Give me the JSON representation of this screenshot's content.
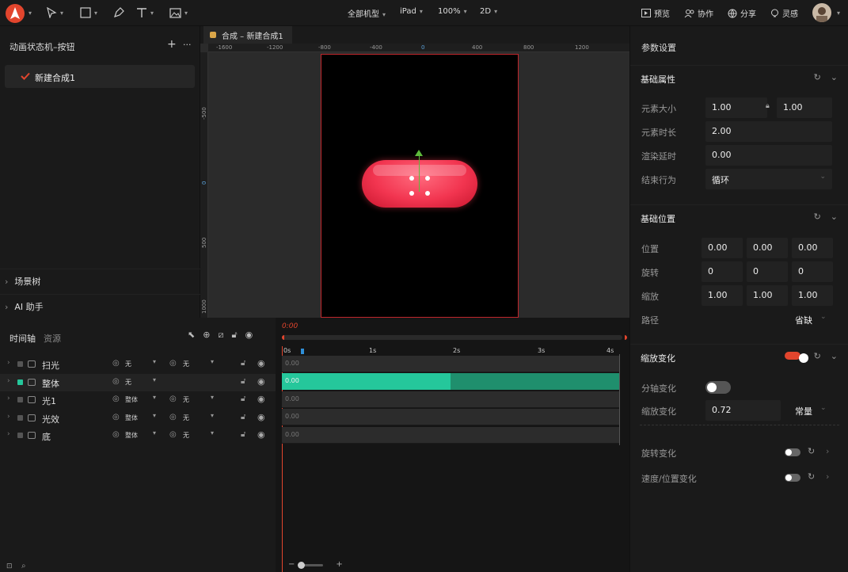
{
  "topbar": {
    "device": "全部机型",
    "ipad": "iPad",
    "zoom": "100%",
    "mode": "2D",
    "preview": "预览",
    "collab": "协作",
    "share": "分享",
    "inspire": "灵感"
  },
  "left": {
    "title": "动画状态机–按钮",
    "add": "+",
    "more": "···",
    "item": "新建合成1",
    "scene_tree": "场景树",
    "ai": "AI 助手"
  },
  "canvas": {
    "tab": "合成 – 新建合成1",
    "ruler_top": [
      "-1600",
      "-1200",
      "-800",
      "-400",
      "0",
      "400",
      "800",
      "1200"
    ],
    "ruler_left": [
      "-500",
      "0",
      "500",
      "1000"
    ]
  },
  "timeline": {
    "tab_active": "时间轴",
    "tab_other": "资源",
    "time": "0:00",
    "ticks": [
      "0s",
      "1s",
      "2s",
      "3s",
      "4s"
    ],
    "layers": [
      {
        "name": "扫光",
        "v1": "无",
        "v2": "无",
        "sel": false,
        "color": "#555555"
      },
      {
        "name": "整体",
        "v1": "无",
        "v2": "",
        "sel": true,
        "color": "#25c79b"
      },
      {
        "name": "光1",
        "v1": "整体",
        "v2": "无",
        "sel": false,
        "color": "#555555"
      },
      {
        "name": "光效",
        "v1": "整体",
        "v2": "无",
        "sel": false,
        "color": "#555555"
      },
      {
        "name": "底",
        "v1": "整体",
        "v2": "无",
        "sel": false,
        "color": "#555555"
      }
    ],
    "track_values": [
      "0.00",
      "0.00",
      "0.00",
      "0.00",
      "0.00"
    ]
  },
  "right": {
    "title": "参数设置",
    "basic": "基础属性",
    "size_label": "元素大小",
    "size_w": "1.00",
    "size_h": "1.00",
    "duration_label": "元素时长",
    "duration": "2.00",
    "delay_label": "渲染延时",
    "delay": "0.00",
    "end_label": "结束行为",
    "end": "循环",
    "pos_section": "基础位置",
    "pos_label": "位置",
    "pos": [
      "0.00",
      "0.00",
      "0.00"
    ],
    "rot_label": "旋转",
    "rot": [
      "0",
      "0",
      "0"
    ],
    "scale_label": "缩放",
    "scale": [
      "1.00",
      "1.00",
      "1.00"
    ],
    "path_label": "路径",
    "path": "省缺",
    "scale_change": "缩放变化",
    "axis_label": "分轴变化",
    "scale_change_label": "缩放变化",
    "scale_value": "0.72",
    "scale_mode": "常量",
    "rot_change": "旋转变化",
    "speed_change": "速度/位置变化"
  }
}
